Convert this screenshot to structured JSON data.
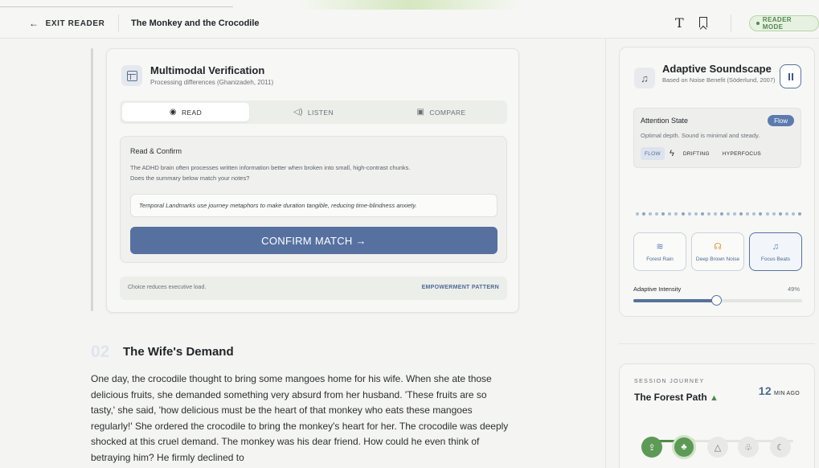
{
  "topbar": {
    "exit_label": "EXIT READER",
    "doc_title": "The Monkey and the Crocodile",
    "reader_mode": "READER MODE"
  },
  "verification": {
    "title": "Multimodal Verification",
    "subtitle": "Processing differences (Ghanizadeh, 2011)",
    "tabs": [
      {
        "label": "READ",
        "icon": "eye-icon"
      },
      {
        "label": "LISTEN",
        "icon": "speaker-icon"
      },
      {
        "label": "COMPARE",
        "icon": "compare-icon"
      }
    ],
    "panel_title": "Read & Confirm",
    "panel_body": "The ADHD brain often processes written information better when broken into small, high-contrast chunks. Does the summary below match your notes?",
    "summary": "Temporal Landmarks use journey metaphors to make duration tangible, reducing time-blindness anxiety.",
    "confirm_label": "CONFIRM MATCH →",
    "footer_left": "Choice reduces executive load.",
    "footer_right": "EMPOWERMENT PATTERN"
  },
  "section": {
    "number": "02",
    "title": "The Wife's Demand",
    "body": "One day, the crocodile thought to bring some mangoes home for his wife. When she ate those delicious fruits, she demanded something very absurd from her husband. 'These fruits are so tasty,' she said, 'how delicious must be the heart of that monkey who eats these mangoes regularly!' She ordered the crocodile to bring the monkey's heart for her. The crocodile was deeply shocked at this cruel demand. The monkey was his dear friend. How could he even think of betraying him? He firmly declined to"
  },
  "soundscape": {
    "title": "Adaptive Soundscape",
    "subtitle": "Based on Noise Benefit (Söderlund, 2007)",
    "attention_title": "Attention State",
    "attention_badge": "Flow",
    "attention_desc": "Optimal depth. Sound is minimal and steady.",
    "states": [
      "FLOW",
      "DRIFTING",
      "HYPERFOCUS"
    ],
    "sounds": [
      {
        "label": "Forest Rain",
        "icon": "wind-icon"
      },
      {
        "label": "Deep Brown Noise",
        "icon": "headphones-icon"
      },
      {
        "label": "Focus Beats",
        "icon": "music-note-icon"
      }
    ],
    "intensity_label": "Adaptive Intensity",
    "intensity_value": "49%",
    "intensity": 0.49
  },
  "session": {
    "label": "SESSION JOURNEY",
    "title": "The Forest Path",
    "minutes": "12",
    "minutes_suffix": "MIN AGO"
  }
}
